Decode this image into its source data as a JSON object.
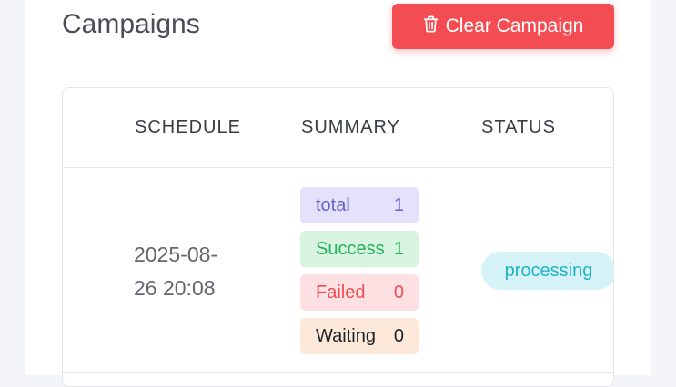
{
  "header": {
    "title": "Campaigns",
    "clear_button_label": "Clear Campaign",
    "clear_button_icon": "trash-icon"
  },
  "table": {
    "columns": [
      "SCHEDULE",
      "SUMMARY",
      "STATUS"
    ],
    "rows": [
      {
        "schedule": "2025-08-26 20:08",
        "schedule_line1": "2025-08-",
        "schedule_line2": "26 20:08",
        "summary": [
          {
            "label": "total",
            "value": "1"
          },
          {
            "label": "Success",
            "value": "1"
          },
          {
            "label": "Failed",
            "value": "0"
          },
          {
            "label": "Waiting",
            "value": "0"
          }
        ],
        "status": "processing"
      }
    ]
  },
  "colors": {
    "danger": "#f34d53",
    "total": "#6b61cf",
    "success": "#23b15a",
    "failed": "#ee4e54",
    "status_processing": "#1fb4c3"
  }
}
